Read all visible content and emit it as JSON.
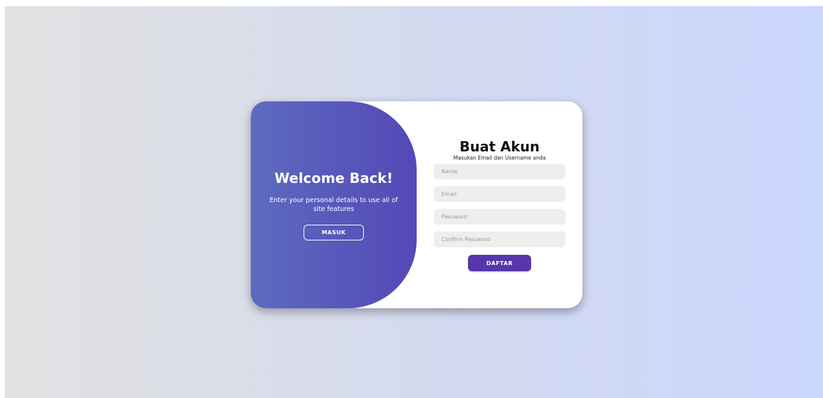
{
  "welcome": {
    "title": "Welcome Back!",
    "text": "Enter your personal details to use all of site features",
    "login_button": "MASUK"
  },
  "register": {
    "title": "Buat Akun",
    "subtitle": "Masukan Email dan Username anda",
    "fields": {
      "name_placeholder": "Name",
      "email_placeholder": "Email",
      "password_placeholder": "Password",
      "confirm_placeholder": "Confirm Password"
    },
    "submit_button": "DAFTAR"
  },
  "colors": {
    "panel_gradient_start": "#5c6bc0",
    "panel_gradient_end": "#5448b6",
    "primary_button": "#5636aa",
    "background_left": "#e2e2e2",
    "background_right": "#c9d6fd"
  }
}
